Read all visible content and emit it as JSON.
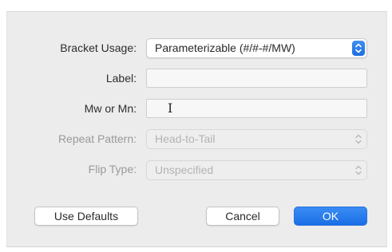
{
  "dialog": {
    "rows": {
      "bracket_usage": {
        "label": "Bracket Usage:",
        "value": "Parameterizable (#/#-#/MW)"
      },
      "label_field": {
        "label": "Label:",
        "value": ""
      },
      "mw_field": {
        "label": "Mw or Mn:",
        "value": ""
      },
      "repeat_pattern": {
        "label": "Repeat Pattern:",
        "value": "Head-to-Tail"
      },
      "flip_type": {
        "label": "Flip Type:",
        "value": "Unspecified"
      }
    },
    "buttons": {
      "use_defaults": "Use Defaults",
      "cancel": "Cancel",
      "ok": "OK"
    },
    "cursor_glyph": "I",
    "colors": {
      "accent": "#1f73e8",
      "dialog_bg": "#ececec",
      "disabled_text": "#b3b3b3"
    },
    "icons": {
      "popup_arrows": "chevron-up-down-icon",
      "text_cursor": "i-beam-cursor-icon"
    }
  }
}
